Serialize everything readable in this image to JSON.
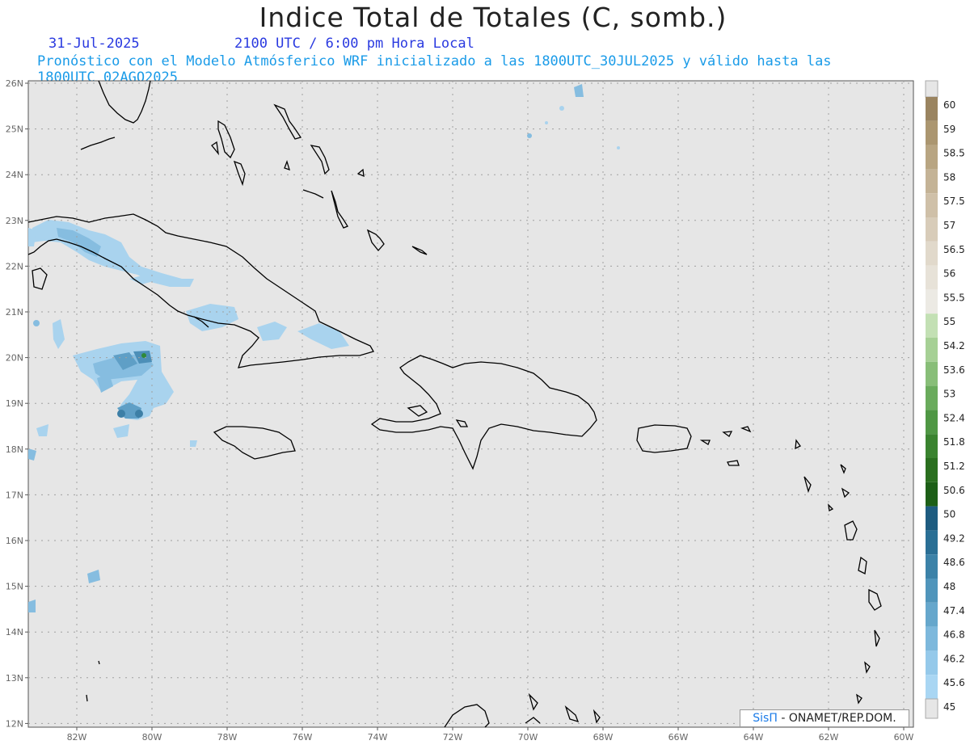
{
  "header": {
    "title": "Indice Total de Totales (C, somb.)",
    "date": "31-Jul-2025",
    "time": "2100 UTC / 6:00 pm Hora Local",
    "description": "Pronóstico con el Modelo Atmósferico WRF inicializado a las 1800UTC_30JUL2025 y válido hasta las  1800UTC_02AGO2025"
  },
  "axes": {
    "lat_labels": [
      "26N",
      "25N",
      "24N",
      "23N",
      "22N",
      "21N",
      "20N",
      "19N",
      "18N",
      "17N",
      "16N",
      "15N",
      "14N",
      "13N",
      "12N"
    ],
    "lon_labels": [
      "82W",
      "80W",
      "78W",
      "76W",
      "74W",
      "72W",
      "70W",
      "68W",
      "66W",
      "64W",
      "62W",
      "60W"
    ]
  },
  "colorbar": {
    "labels": [
      "60",
      "59",
      "58.5",
      "58",
      "57.5",
      "57",
      "56.5",
      "56",
      "55.5",
      "55",
      "54.2",
      "53.6",
      "53",
      "52.4",
      "51.8",
      "51.2",
      "50.6",
      "50",
      "49.2",
      "48.6",
      "48",
      "47.4",
      "46.8",
      "46.2",
      "45.6",
      "45"
    ],
    "colors": [
      "#e6e6e6",
      "#9a8460",
      "#ab9670",
      "#b8a582",
      "#c4b396",
      "#cfc0a8",
      "#d8ccb9",
      "#e1d9cb",
      "#e7e2d8",
      "#eceae4",
      "#c3e0b4",
      "#a6d095",
      "#88be78",
      "#6aab5c",
      "#4f9744",
      "#3a832f",
      "#2a6f1f",
      "#1d5f17",
      "#1e5c80",
      "#2a6f95",
      "#3c82a8",
      "#5095bb",
      "#66a7cc",
      "#7db8dc",
      "#95c9ea",
      "#a9d6f3"
    ]
  },
  "credit": {
    "brand": "SisΠ",
    "text": "- ONAMET/REP.DOM."
  },
  "colors": {
    "background": "#e6e6e6",
    "grid": "#a0a0a0",
    "coast": "#000000",
    "field_light": "#9fcbe8",
    "field_dark": "#2c6e8e"
  }
}
